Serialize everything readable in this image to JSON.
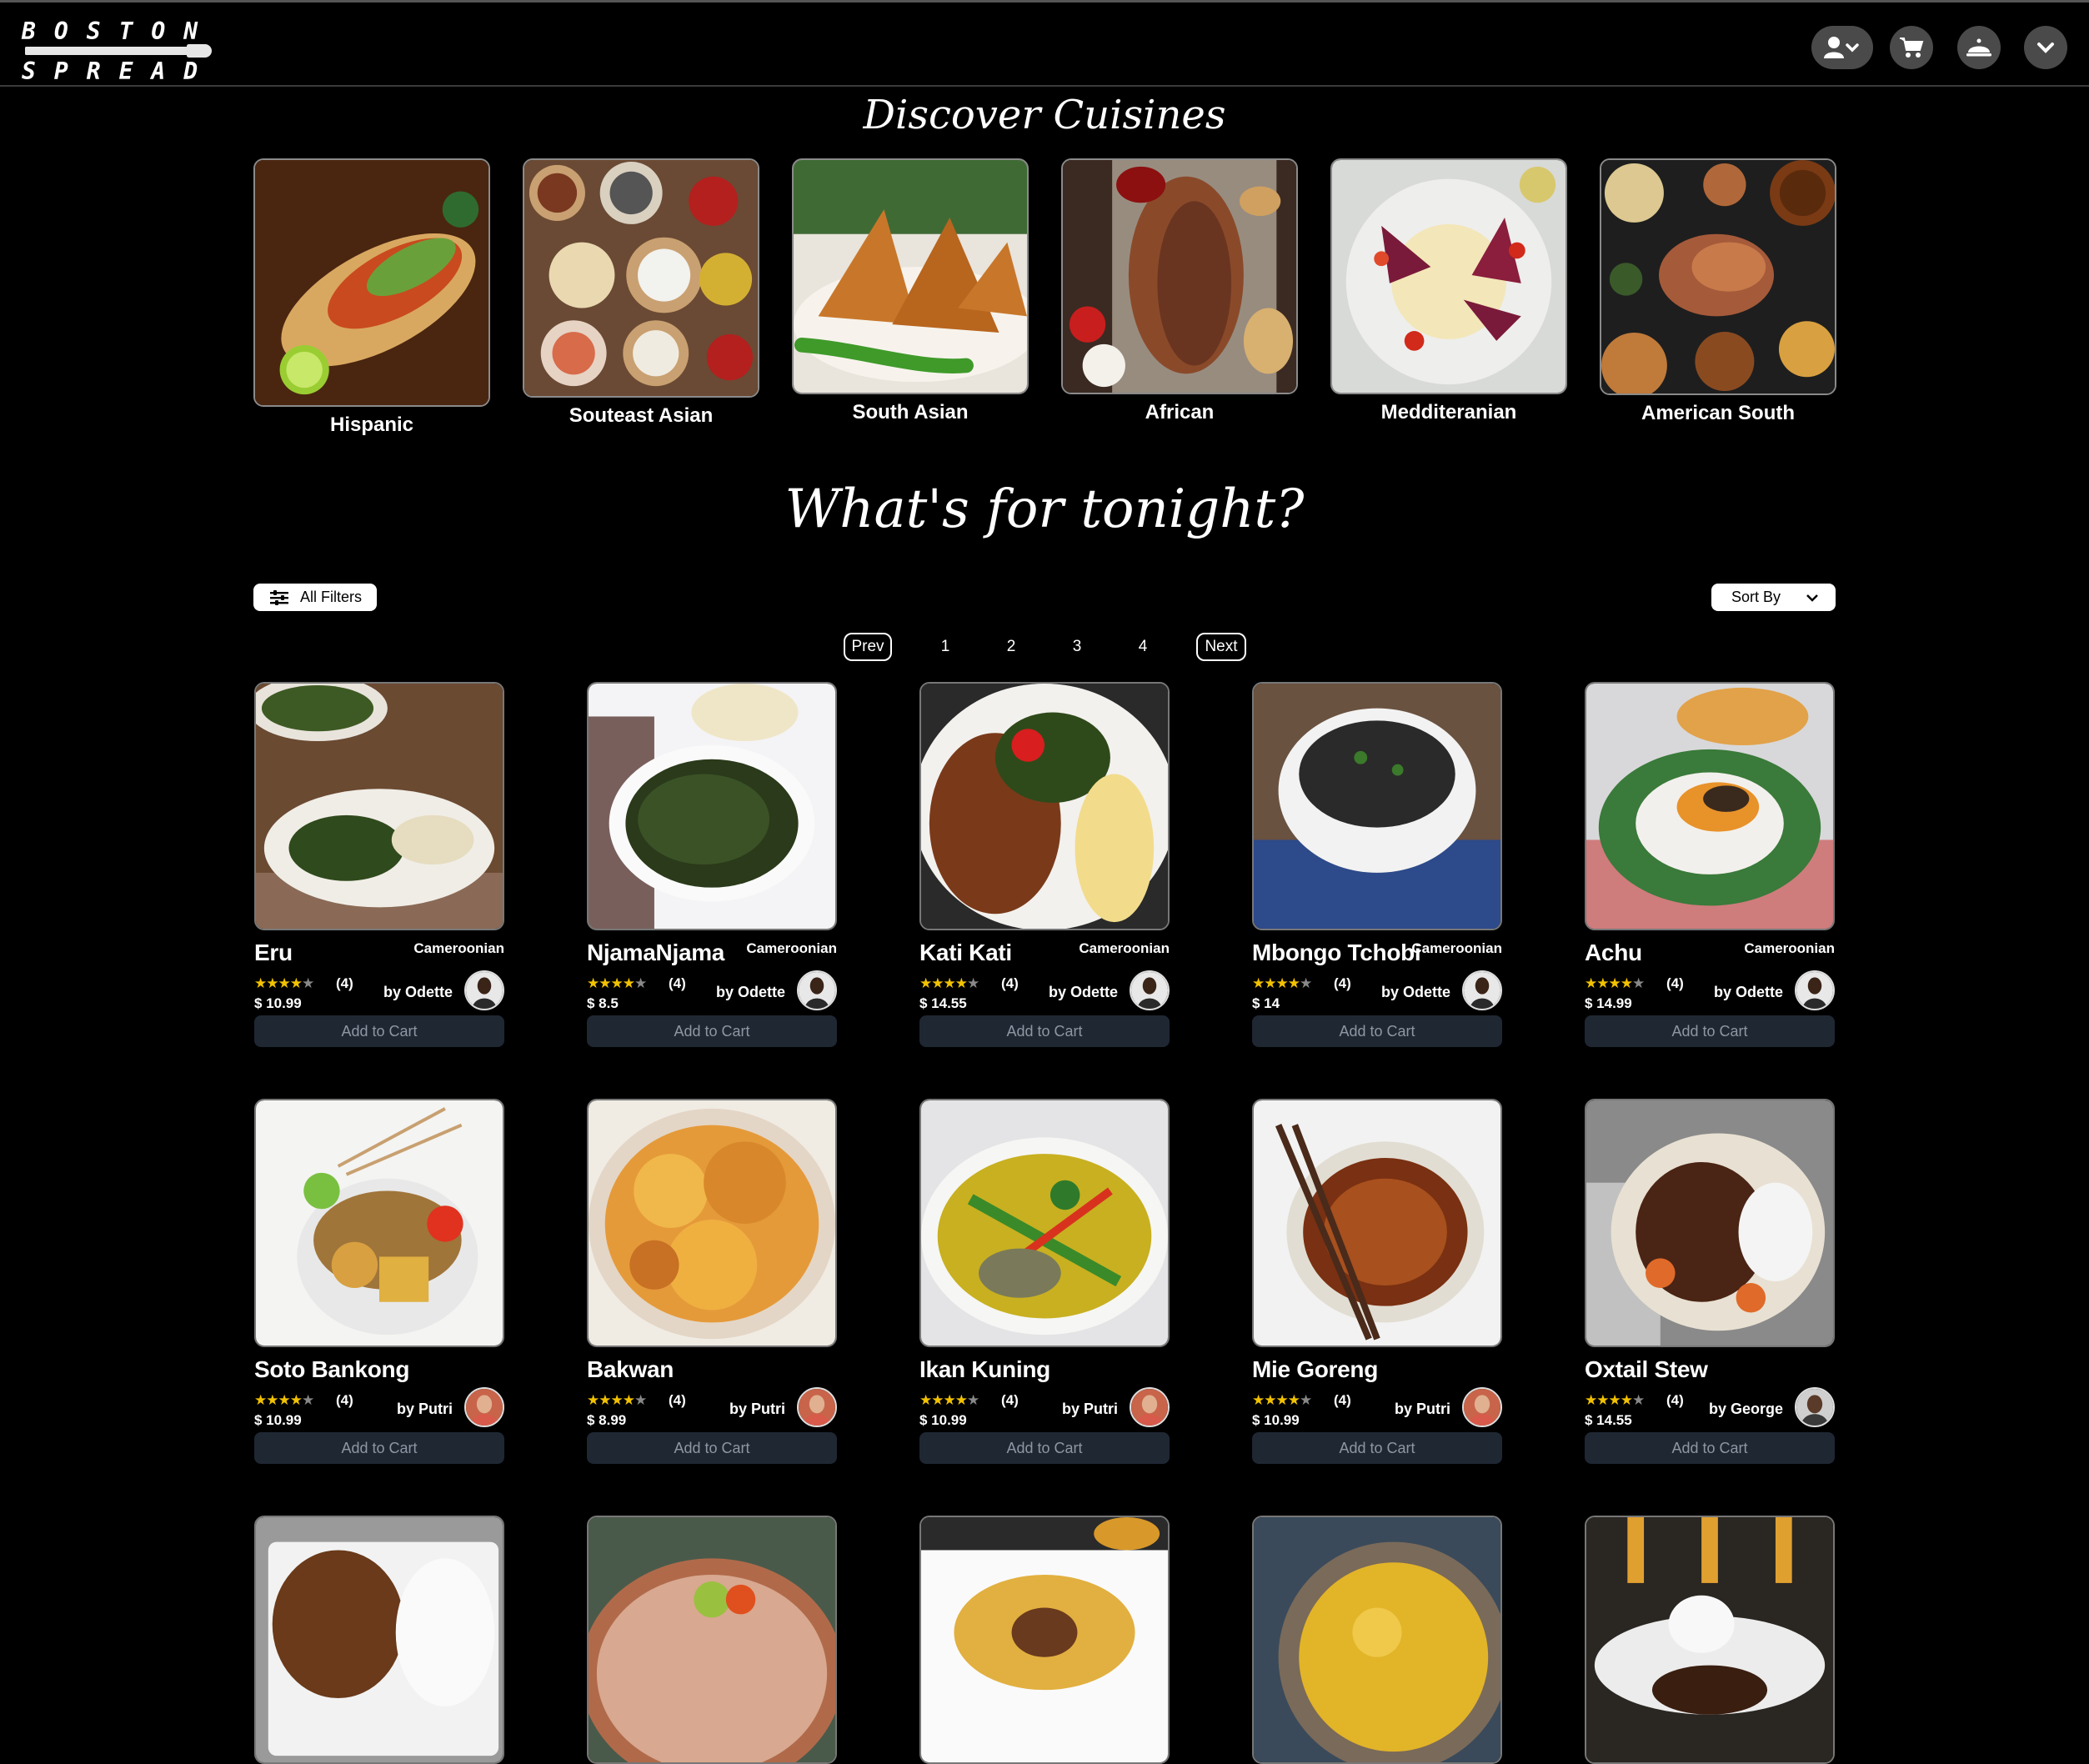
{
  "header": {
    "logo_line1": "BOSTON",
    "logo_line2": "SPREAD",
    "icons": [
      "user-dropdown-icon",
      "cart-icon",
      "cloche-icon",
      "chevron-down-icon"
    ]
  },
  "cuisines": {
    "title": "Discover Cuisines",
    "items": [
      {
        "name": "Hispanic"
      },
      {
        "name": "Souteast Asian"
      },
      {
        "name": "South Asian"
      },
      {
        "name": "African"
      },
      {
        "name": "Medditeranian"
      },
      {
        "name": "American South"
      }
    ]
  },
  "menu": {
    "title": "What's for tonight?",
    "filters_label": "All Filters",
    "sort_label": "Sort By",
    "pagination": {
      "prev": "Prev",
      "pages": [
        "1",
        "2",
        "3",
        "4"
      ],
      "next": "Next"
    },
    "add_to_cart_label": "Add to Cart",
    "dishes": [
      {
        "name": "Eru",
        "cuisine": "Cameroonian",
        "rating": 4,
        "reviews": "(4)",
        "price": "$ 10.99",
        "chef": "by Odette"
      },
      {
        "name": "NjamaNjama",
        "cuisine": "Cameroonian",
        "rating": 4,
        "reviews": "(4)",
        "price": "$ 8.5",
        "chef": "by Odette"
      },
      {
        "name": "Kati Kati",
        "cuisine": "Cameroonian",
        "rating": 4,
        "reviews": "(4)",
        "price": "$ 14.55",
        "chef": "by Odette"
      },
      {
        "name": "Mbongo Tchobi",
        "cuisine": "Cameroonian",
        "rating": 4,
        "reviews": "(4)",
        "price": "$ 14",
        "chef": "by Odette"
      },
      {
        "name": "Achu",
        "cuisine": "Cameroonian",
        "rating": 4,
        "reviews": "(4)",
        "price": "$ 14.99",
        "chef": "by Odette"
      },
      {
        "name": "Soto Bankong",
        "cuisine": "",
        "rating": 4,
        "reviews": "(4)",
        "price": "$ 10.99",
        "chef": "by Putri"
      },
      {
        "name": "Bakwan",
        "cuisine": "",
        "rating": 4,
        "reviews": "(4)",
        "price": "$ 8.99",
        "chef": "by Putri"
      },
      {
        "name": "Ikan Kuning",
        "cuisine": "",
        "rating": 4,
        "reviews": "(4)",
        "price": "$ 10.99",
        "chef": "by Putri"
      },
      {
        "name": "Mie Goreng",
        "cuisine": "",
        "rating": 4,
        "reviews": "(4)",
        "price": "$ 10.99",
        "chef": "by Putri"
      },
      {
        "name": "Oxtail Stew",
        "cuisine": "",
        "rating": 4,
        "reviews": "(4)",
        "price": "$ 14.55",
        "chef": "by George"
      }
    ]
  },
  "colors": {
    "background": "#000000",
    "star": "#f2c200",
    "cart_button": "#1f2733"
  }
}
